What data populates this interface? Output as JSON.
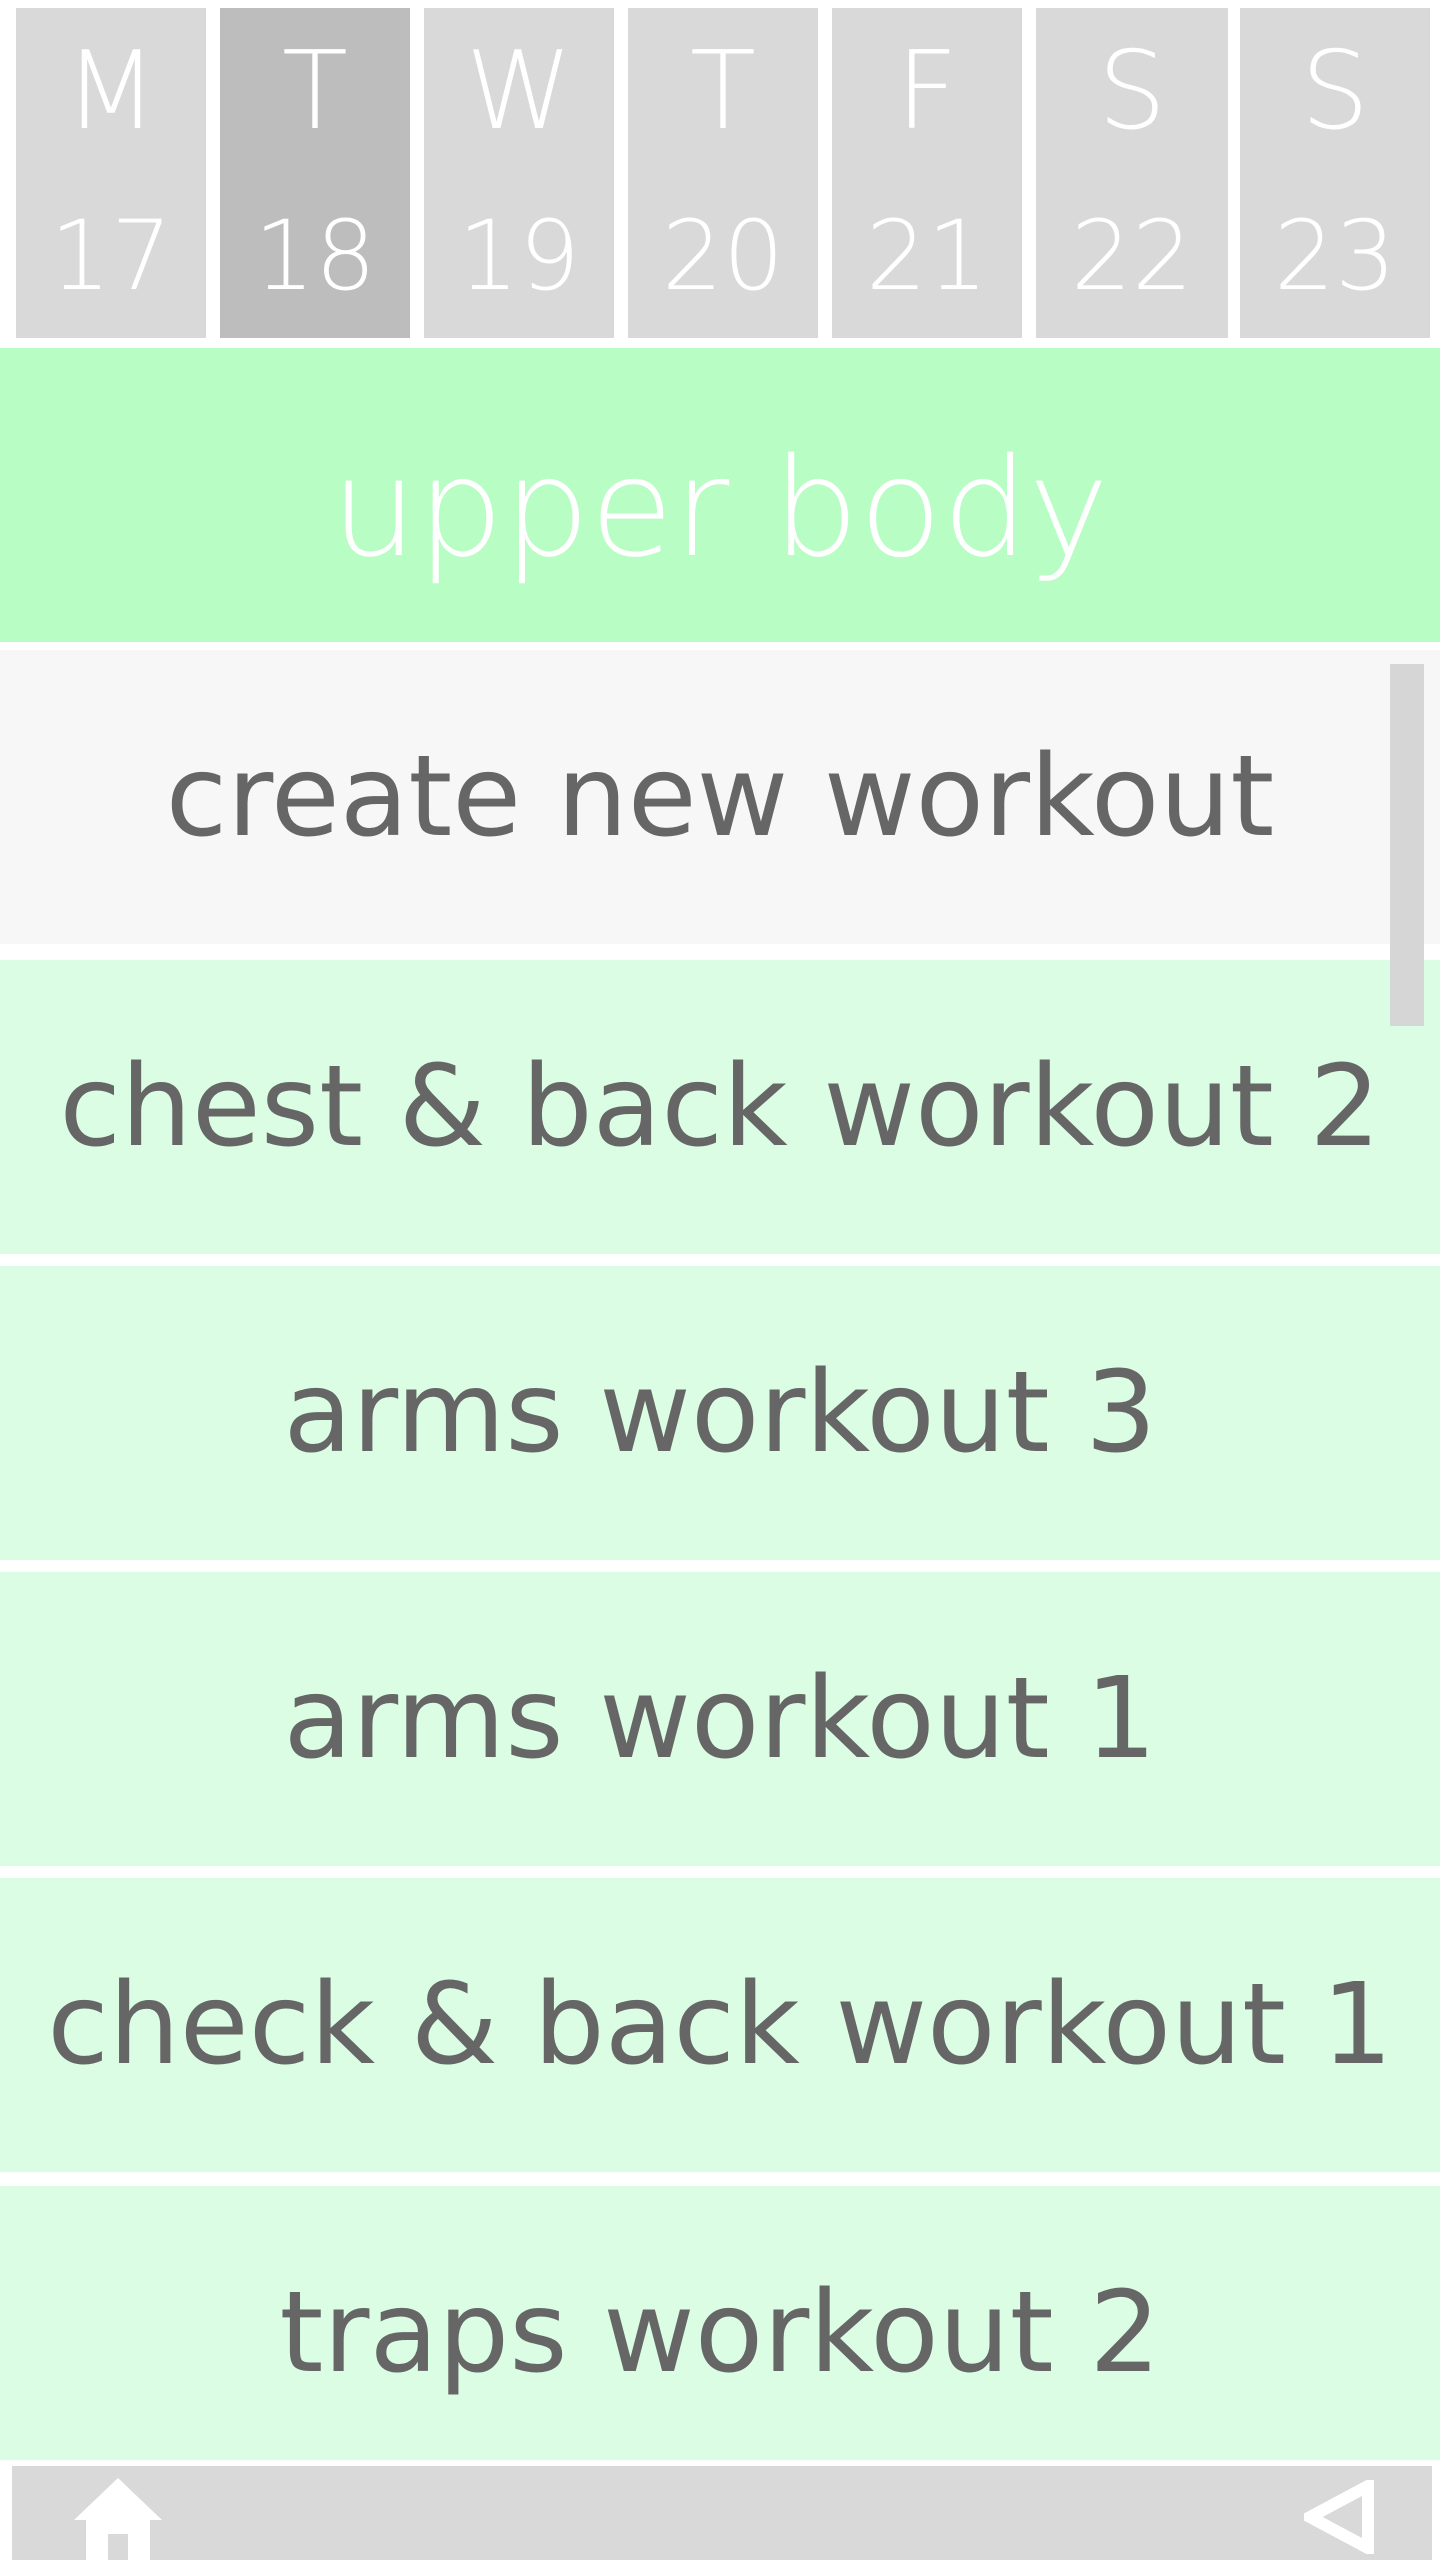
{
  "week": {
    "days": [
      {
        "letter": "M",
        "date": "17"
      },
      {
        "letter": "T",
        "date": "18"
      },
      {
        "letter": "W",
        "date": "19"
      },
      {
        "letter": "T",
        "date": "20"
      },
      {
        "letter": "F",
        "date": "21"
      },
      {
        "letter": "S",
        "date": "22"
      },
      {
        "letter": "S",
        "date": "23"
      }
    ],
    "selected_index": 1
  },
  "header": {
    "title": "upper body"
  },
  "list": {
    "create_label": "create new workout",
    "items": [
      "chest & back workout 2",
      "arms workout 3",
      "arms workout 1",
      "check & back workout 1",
      "traps workout 2"
    ]
  },
  "bottom_bar": {
    "left_icon": "home-icon",
    "right_icon": "back-icon"
  },
  "colors": {
    "header_bg": "#b7fdc4",
    "item_bg": "#dafde3",
    "create_bg": "#f7f7f7",
    "day_bg": "#d9d9d9",
    "day_selected_bg": "#bdbdbd",
    "text": "#666666"
  }
}
